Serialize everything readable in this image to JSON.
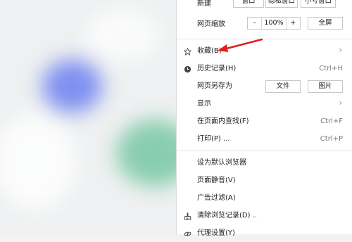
{
  "menu": {
    "new_row": {
      "label": "新建",
      "window_button": "窗口",
      "incognito_button": "隐私窗口",
      "small_window_button": "小号窗口"
    },
    "zoom_row": {
      "label": "网页缩放",
      "minus": "-",
      "zoom_value": "100%",
      "plus": "+",
      "fullscreen": "全屏"
    },
    "favorites": {
      "label": "收藏(B)"
    },
    "history": {
      "label": "历史记录(H)",
      "shortcut": "Ctrl+H"
    },
    "save_as": {
      "label": "网页另存为",
      "file_button": "文件",
      "image_button": "图片"
    },
    "display": {
      "label": "显示"
    },
    "find": {
      "label": "在页面内查找(F)",
      "shortcut": "Ctrl+F"
    },
    "print": {
      "label": "打印(P) ...",
      "shortcut": "Ctrl+P"
    },
    "set_default": {
      "label": "设为默认浏览器"
    },
    "mute": {
      "label": "页面静音(V)"
    },
    "ad_filter": {
      "label": "广告过滤(A)"
    },
    "clear_history": {
      "label": "清除浏览记录(D) .."
    },
    "proxy": {
      "label": "代理设置(Y)"
    }
  },
  "annotation": {
    "arrow_color": "#e02020"
  }
}
